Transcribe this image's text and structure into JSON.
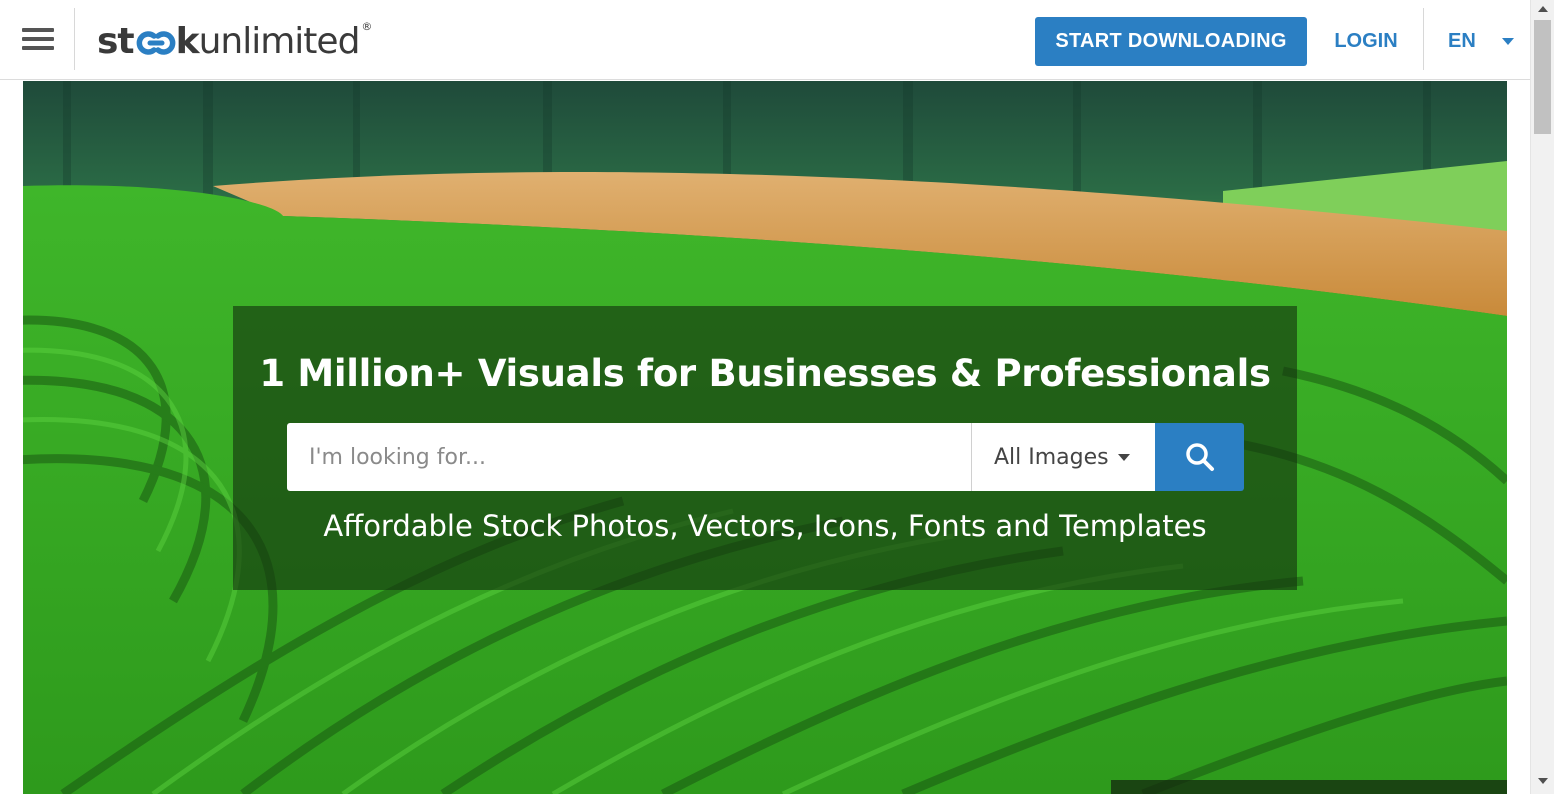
{
  "header": {
    "logo": {
      "part_bold_start": "st",
      "part_bold_end": "k",
      "part_light": "unlimited",
      "registered_mark": "®"
    },
    "start_button_label": "START DOWNLOADING",
    "login_label": "LOGIN",
    "language_label": "EN"
  },
  "hero": {
    "title": "1 Million+ Visuals for Businesses & Professionals",
    "search": {
      "placeholder": "I'm looking for...",
      "value": "",
      "category_selected": "All Images"
    },
    "subtitle": "Affordable Stock Photos, Vectors, Icons, Fonts and Templates"
  },
  "icons": {
    "menu": "hamburger-menu-icon",
    "search": "search-icon",
    "lang_caret": "chevron-down-icon",
    "select_caret": "chevron-down-icon"
  },
  "colors": {
    "brand_blue": "#2b7fc3",
    "logo_text": "#3a3a3a",
    "panel_overlay": "rgba(20, 50, 15, 0.62)"
  }
}
